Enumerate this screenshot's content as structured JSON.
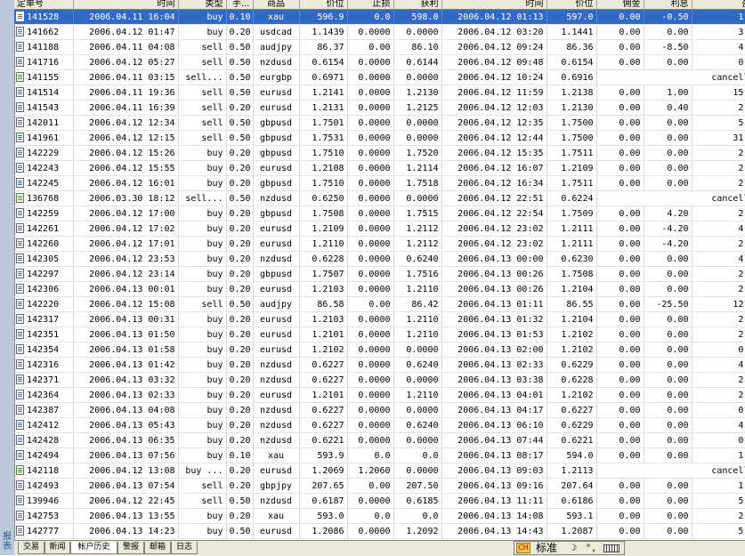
{
  "side_label": "报表",
  "columns": [
    {
      "key": "ticket",
      "label": "定单号",
      "align": "left"
    },
    {
      "key": "open_time",
      "label": "时间",
      "align": "right"
    },
    {
      "key": "type",
      "label": "类型",
      "align": "right"
    },
    {
      "key": "size",
      "label": "手...",
      "align": "right"
    },
    {
      "key": "symbol",
      "label": "商品",
      "align": "center"
    },
    {
      "key": "open_price",
      "label": "价位",
      "align": "right"
    },
    {
      "key": "sl",
      "label": "止损",
      "align": "right"
    },
    {
      "key": "tp",
      "label": "获利",
      "align": "right"
    },
    {
      "key": "close_time",
      "label": "时间",
      "align": "right"
    },
    {
      "key": "close_price",
      "label": "价位",
      "align": "right"
    },
    {
      "key": "commission",
      "label": "佣金",
      "align": "right"
    },
    {
      "key": "swap",
      "label": "利息",
      "align": "right"
    },
    {
      "key": "profit",
      "label": "盈亏",
      "align": "right"
    }
  ],
  "rows": [
    {
      "ticket": "141528",
      "open_time": "2006.04.11 16:04",
      "type": "buy",
      "size": "0.10",
      "symbol": "xau",
      "open_price": "596.9",
      "sl": "0.0",
      "tp": "598.0",
      "close_time": "2006.04.12 01:13",
      "close_price": "597.0",
      "commission": "0.00",
      "swap": "-0.50",
      "profit": "1.00",
      "selected": true
    },
    {
      "ticket": "141662",
      "open_time": "2006.04.12 01:47",
      "type": "buy",
      "size": "0.20",
      "symbol": "usdcad",
      "open_price": "1.1439",
      "sl": "0.0000",
      "tp": "0.0000",
      "close_time": "2006.04.12 03:20",
      "close_price": "1.1441",
      "commission": "0.00",
      "swap": "0.00",
      "profit": "3.50"
    },
    {
      "ticket": "141188",
      "open_time": "2006.04.11 04:08",
      "type": "sell",
      "size": "0.50",
      "symbol": "audjpy",
      "open_price": "86.37",
      "sl": "0.00",
      "tp": "86.10",
      "close_time": "2006.04.12 09:24",
      "close_price": "86.36",
      "commission": "0.00",
      "swap": "-8.50",
      "profit": "4.23"
    },
    {
      "ticket": "141716",
      "open_time": "2006.04.12 05:27",
      "type": "sell",
      "size": "0.50",
      "symbol": "nzdusd",
      "open_price": "0.6154",
      "sl": "0.0000",
      "tp": "0.6144",
      "close_time": "2006.04.12 09:48",
      "close_price": "0.6154",
      "commission": "0.00",
      "swap": "0.00",
      "profit": "0.00"
    },
    {
      "ticket": "141155",
      "open_time": "2006.04.11 03:15",
      "type": "sell...",
      "size": "0.50",
      "symbol": "eurgbp",
      "open_price": "0.6971",
      "sl": "0.0000",
      "tp": "0.0000",
      "close_time": "2006.04.12 10:24",
      "close_price": "0.6916",
      "cancelled": "cancelled",
      "pending": true
    },
    {
      "ticket": "141514",
      "open_time": "2006.04.11 19:36",
      "type": "sell",
      "size": "0.50",
      "symbol": "eurusd",
      "open_price": "1.2141",
      "sl": "0.0000",
      "tp": "1.2130",
      "close_time": "2006.04.12 11:59",
      "close_price": "1.2138",
      "commission": "0.00",
      "swap": "1.00",
      "profit": "15.00"
    },
    {
      "ticket": "141543",
      "open_time": "2006.04.11 16:39",
      "type": "sell",
      "size": "0.20",
      "symbol": "eurusd",
      "open_price": "1.2131",
      "sl": "0.0000",
      "tp": "1.2125",
      "close_time": "2006.04.12 12:03",
      "close_price": "1.2130",
      "commission": "0.00",
      "swap": "0.40",
      "profit": "2.00"
    },
    {
      "ticket": "142011",
      "open_time": "2006.04.12 12:34",
      "type": "sell",
      "size": "0.50",
      "symbol": "gbpusd",
      "open_price": "1.7501",
      "sl": "0.0000",
      "tp": "0.0000",
      "close_time": "2006.04.12 12:35",
      "close_price": "1.7500",
      "commission": "0.00",
      "swap": "0.00",
      "profit": "5.00"
    },
    {
      "ticket": "141961",
      "open_time": "2006.04.12 12:15",
      "type": "sell",
      "size": "0.50",
      "symbol": "gbpusd",
      "open_price": "1.7531",
      "sl": "0.0000",
      "tp": "0.0000",
      "close_time": "2006.04.12 12:44",
      "close_price": "1.7500",
      "commission": "0.00",
      "swap": "0.00",
      "profit": "31.00"
    },
    {
      "ticket": "142229",
      "open_time": "2006.04.12 15:26",
      "type": "buy",
      "size": "0.20",
      "symbol": "gbpusd",
      "open_price": "1.7510",
      "sl": "0.0000",
      "tp": "1.7520",
      "close_time": "2006.04.12 15:35",
      "close_price": "1.7511",
      "commission": "0.00",
      "swap": "0.00",
      "profit": "2.00"
    },
    {
      "ticket": "142243",
      "open_time": "2006.04.12 15:55",
      "type": "buy",
      "size": "0.20",
      "symbol": "eurusd",
      "open_price": "1.2108",
      "sl": "0.0000",
      "tp": "1.2114",
      "close_time": "2006.04.12 16:07",
      "close_price": "1.2109",
      "commission": "0.00",
      "swap": "0.00",
      "profit": "2.00"
    },
    {
      "ticket": "142245",
      "open_time": "2006.04.12 16:01",
      "type": "buy",
      "size": "0.20",
      "symbol": "gbpusd",
      "open_price": "1.7510",
      "sl": "0.0000",
      "tp": "1.7518",
      "close_time": "2006.04.12 16:34",
      "close_price": "1.7511",
      "commission": "0.00",
      "swap": "0.00",
      "profit": "2.00"
    },
    {
      "ticket": "136768",
      "open_time": "2006.03.30 18:12",
      "type": "sell...",
      "size": "0.50",
      "symbol": "nzdusd",
      "open_price": "0.6250",
      "sl": "0.0000",
      "tp": "0.0000",
      "close_time": "2006.04.12 22:51",
      "close_price": "0.6224",
      "cancelled": "cancelled",
      "pending": true
    },
    {
      "ticket": "142259",
      "open_time": "2006.04.12 17:00",
      "type": "buy",
      "size": "0.20",
      "symbol": "gbpusd",
      "open_price": "1.7508",
      "sl": "0.0000",
      "tp": "1.7515",
      "close_time": "2006.04.12 22:54",
      "close_price": "1.7509",
      "commission": "0.00",
      "swap": "4.20",
      "profit": "2.00"
    },
    {
      "ticket": "142261",
      "open_time": "2006.04.12 17:02",
      "type": "buy",
      "size": "0.20",
      "symbol": "eurusd",
      "open_price": "1.2109",
      "sl": "0.0000",
      "tp": "1.2112",
      "close_time": "2006.04.12 23:02",
      "close_price": "1.2111",
      "commission": "0.00",
      "swap": "-4.20",
      "profit": "4.00"
    },
    {
      "ticket": "142260",
      "open_time": "2006.04.12 17:01",
      "type": "buy",
      "size": "0.20",
      "symbol": "eurusd",
      "open_price": "1.2110",
      "sl": "0.0000",
      "tp": "1.2112",
      "close_time": "2006.04.12 23:02",
      "close_price": "1.2111",
      "commission": "0.00",
      "swap": "-4.20",
      "profit": "2.00"
    },
    {
      "ticket": "142305",
      "open_time": "2006.04.12 23:53",
      "type": "buy",
      "size": "0.20",
      "symbol": "nzdusd",
      "open_price": "0.6228",
      "sl": "0.0000",
      "tp": "0.6240",
      "close_time": "2006.04.13 00:00",
      "close_price": "0.6230",
      "commission": "0.00",
      "swap": "0.00",
      "profit": "4.00"
    },
    {
      "ticket": "142297",
      "open_time": "2006.04.12 23:14",
      "type": "buy",
      "size": "0.20",
      "symbol": "gbpusd",
      "open_price": "1.7507",
      "sl": "0.0000",
      "tp": "1.7516",
      "close_time": "2006.04.13 00:26",
      "close_price": "1.7508",
      "commission": "0.00",
      "swap": "0.00",
      "profit": "2.00"
    },
    {
      "ticket": "142306",
      "open_time": "2006.04.13 00:01",
      "type": "buy",
      "size": "0.20",
      "symbol": "eurusd",
      "open_price": "1.2103",
      "sl": "0.0000",
      "tp": "1.2110",
      "close_time": "2006.04.13 00:26",
      "close_price": "1.2104",
      "commission": "0.00",
      "swap": "0.00",
      "profit": "2.00"
    },
    {
      "ticket": "142220",
      "open_time": "2006.04.12 15:08",
      "type": "sell",
      "size": "0.50",
      "symbol": "audjpy",
      "open_price": "86.58",
      "sl": "0.00",
      "tp": "86.42",
      "close_time": "2006.04.13 01:11",
      "close_price": "86.55",
      "commission": "0.00",
      "swap": "-25.50",
      "profit": "12.66"
    },
    {
      "ticket": "142317",
      "open_time": "2006.04.13 00:31",
      "type": "buy",
      "size": "0.20",
      "symbol": "eurusd",
      "open_price": "1.2103",
      "sl": "0.0000",
      "tp": "1.2110",
      "close_time": "2006.04.13 01:32",
      "close_price": "1.2104",
      "commission": "0.00",
      "swap": "0.00",
      "profit": "2.00"
    },
    {
      "ticket": "142351",
      "open_time": "2006.04.13 01:50",
      "type": "buy",
      "size": "0.20",
      "symbol": "eurusd",
      "open_price": "1.2101",
      "sl": "0.0000",
      "tp": "1.2110",
      "close_time": "2006.04.13 01:53",
      "close_price": "1.2102",
      "commission": "0.00",
      "swap": "0.00",
      "profit": "2.00"
    },
    {
      "ticket": "142354",
      "open_time": "2006.04.13 01:58",
      "type": "buy",
      "size": "0.20",
      "symbol": "eurusd",
      "open_price": "1.2102",
      "sl": "0.0000",
      "tp": "0.0000",
      "close_time": "2006.04.13 02:00",
      "close_price": "1.2102",
      "commission": "0.00",
      "swap": "0.00",
      "profit": "0.00"
    },
    {
      "ticket": "142316",
      "open_time": "2006.04.13 01:42",
      "type": "buy",
      "size": "0.20",
      "symbol": "nzdusd",
      "open_price": "0.6227",
      "sl": "0.0000",
      "tp": "0.6240",
      "close_time": "2006.04.13 02:33",
      "close_price": "0.6229",
      "commission": "0.00",
      "swap": "0.00",
      "profit": "4.00"
    },
    {
      "ticket": "142371",
      "open_time": "2006.04.13 03:32",
      "type": "buy",
      "size": "0.20",
      "symbol": "nzdusd",
      "open_price": "0.6227",
      "sl": "0.0000",
      "tp": "0.0000",
      "close_time": "2006.04.13 03:38",
      "close_price": "0.6228",
      "commission": "0.00",
      "swap": "0.00",
      "profit": "2.00"
    },
    {
      "ticket": "142364",
      "open_time": "2006.04.13 02:33",
      "type": "buy",
      "size": "0.20",
      "symbol": "eurusd",
      "open_price": "1.2101",
      "sl": "0.0000",
      "tp": "1.2110",
      "close_time": "2006.04.13 04:01",
      "close_price": "1.2102",
      "commission": "0.00",
      "swap": "0.00",
      "profit": "2.00"
    },
    {
      "ticket": "142387",
      "open_time": "2006.04.13 04:08",
      "type": "buy",
      "size": "0.20",
      "symbol": "nzdusd",
      "open_price": "0.6227",
      "sl": "0.0000",
      "tp": "0.0000",
      "close_time": "2006.04.13 04:17",
      "close_price": "0.6227",
      "commission": "0.00",
      "swap": "0.00",
      "profit": "0.00"
    },
    {
      "ticket": "142412",
      "open_time": "2006.04.13 05:43",
      "type": "buy",
      "size": "0.20",
      "symbol": "nzdusd",
      "open_price": "0.6227",
      "sl": "0.0000",
      "tp": "0.6240",
      "close_time": "2006.04.13 06:10",
      "close_price": "0.6229",
      "commission": "0.00",
      "swap": "0.00",
      "profit": "4.00"
    },
    {
      "ticket": "142428",
      "open_time": "2006.04.13 06:35",
      "type": "buy",
      "size": "0.20",
      "symbol": "nzdusd",
      "open_price": "0.6221",
      "sl": "0.0000",
      "tp": "0.0000",
      "close_time": "2006.04.13 07:44",
      "close_price": "0.6221",
      "commission": "0.00",
      "swap": "0.00",
      "profit": "0.00"
    },
    {
      "ticket": "142494",
      "open_time": "2006.04.13 07:56",
      "type": "buy",
      "size": "0.10",
      "symbol": "xau",
      "open_price": "593.9",
      "sl": "0.0",
      "tp": "0.0",
      "close_time": "2006.04.13 08:17",
      "close_price": "594.0",
      "commission": "0.00",
      "swap": "0.00",
      "profit": "1.00"
    },
    {
      "ticket": "142118",
      "open_time": "2006.04.12 13:08",
      "type": "buy ...",
      "size": "0.20",
      "symbol": "eurusd",
      "open_price": "1.2069",
      "sl": "1.2060",
      "tp": "0.0000",
      "close_time": "2006.04.13 09:03",
      "close_price": "1.2113",
      "cancelled": "cancelled",
      "pending": true
    },
    {
      "ticket": "142493",
      "open_time": "2006.04.13 07:54",
      "type": "sell",
      "size": "0.20",
      "symbol": "gbpjpy",
      "open_price": "207.65",
      "sl": "0.00",
      "tp": "207.50",
      "close_time": "2006.04.13 09:16",
      "close_price": "207.64",
      "commission": "0.00",
      "swap": "0.00",
      "profit": "1.69"
    },
    {
      "ticket": "139946",
      "open_time": "2006.04.12 22:45",
      "type": "sell",
      "size": "0.50",
      "symbol": "nzdusd",
      "open_price": "0.6187",
      "sl": "0.0000",
      "tp": "0.6185",
      "close_time": "2006.04.13 11:11",
      "close_price": "0.6186",
      "commission": "0.00",
      "swap": "0.00",
      "profit": "5.00"
    },
    {
      "ticket": "142753",
      "open_time": "2006.04.13 13:55",
      "type": "buy",
      "size": "0.20",
      "symbol": "xau",
      "open_price": "593.0",
      "sl": "0.0",
      "tp": "0.0",
      "close_time": "2006.04.13 14:08",
      "close_price": "593.1",
      "commission": "0.00",
      "swap": "0.00",
      "profit": "2.00"
    },
    {
      "ticket": "142777",
      "open_time": "2006.04.13 14:23",
      "type": "buy",
      "size": "0.50",
      "symbol": "eurusd",
      "open_price": "1.2086",
      "sl": "0.0000",
      "tp": "1.2092",
      "close_time": "2006.04.13 14:43",
      "close_price": "1.2087",
      "commission": "0.00",
      "swap": "0.00",
      "profit": "5.00"
    }
  ],
  "tabs": [
    {
      "label": "交易",
      "active": false
    },
    {
      "label": "新闻",
      "active": false
    },
    {
      "label": "帐户历史",
      "active": true
    },
    {
      "label": "警报",
      "active": false
    },
    {
      "label": "邮箱",
      "active": false
    },
    {
      "label": "日志",
      "active": false
    }
  ],
  "ime": {
    "logo": "CH",
    "mode": "标准",
    "moon": "☽",
    "punct": "°,"
  },
  "colors": {
    "selection": "#3169c6",
    "header_bg": "#ece9d8",
    "side_strip": "#b9c9da"
  }
}
